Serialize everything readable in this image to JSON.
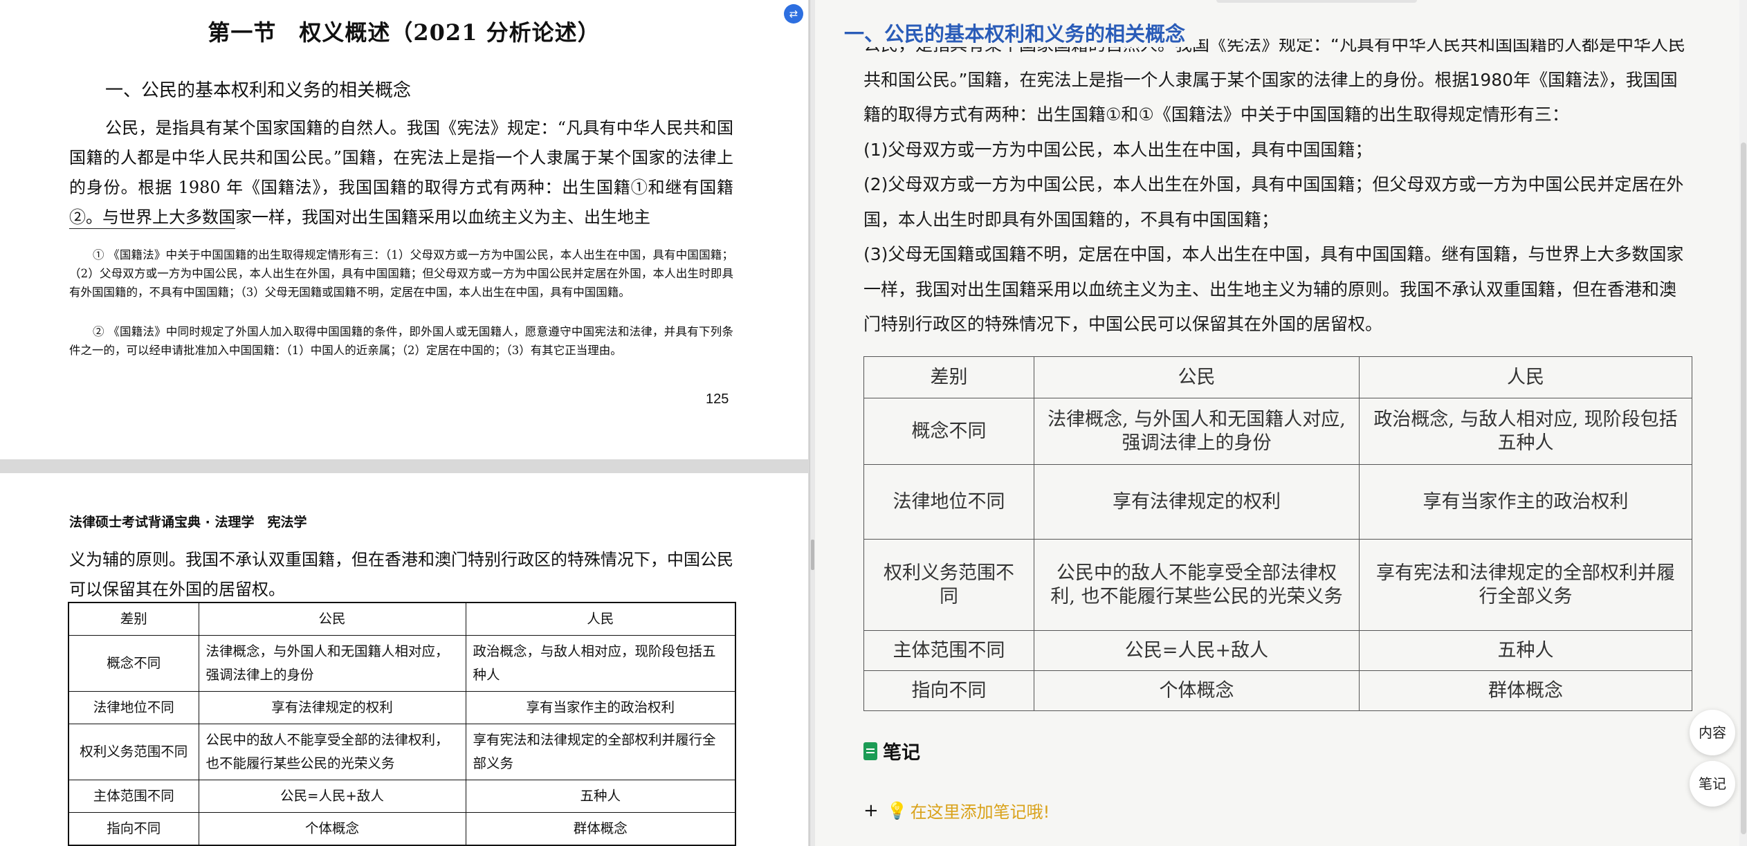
{
  "left_pdf": {
    "page1": {
      "section_title": "第一节　权义概述（2021 分析论述）",
      "subtitle": "一、公民的基本权利和义务的相关概念",
      "body": "公民，是指具有某个国家国籍的自然人。我国《宪法》规定：“凡具有中华人民共和国国籍的人都是中华人民共和国公民。”国籍，在宪法上是指一个人隶属于某个国家的法律上的身份。根据 1980 年《国籍法》，我国国籍的取得方式有两种：出生国籍①和继有国籍②。与世界上大多数国家一样，我国对出生国籍采用以血统主义为主、出生地主",
      "footnote1": "① 《国籍法》中关于中国国籍的出生取得规定情形有三：（1）父母双方或一方为中国公民，本人出生在中国，具有中国国籍；（2）父母双方或一方为中国公民，本人出生在外国，具有中国国籍；但父母双方或一方为中国公民并定居在外国，本人出生时即具有外国国籍的，不具有中国国籍；（3）父母无国籍或国籍不明，定居在中国，本人出生在中国，具有中国国籍。",
      "footnote2": "② 《国籍法》中同时规定了外国人加入取得中国国籍的条件，即外国人或无国籍人，愿意遵守中国宪法和法律，并具有下列条件之一的，可以经申请批准加入中国国籍：（1）中国人的近亲属；（2）定居在中国的；（3）有其它正当理由。",
      "page_number": "125"
    },
    "page2": {
      "header": "法律硕士考试背诵宝典 · 法理学　宪法学",
      "body": "义为辅的原则。我国不承认双重国籍，但在香港和澳门特别行政区的特殊情况下，中国公民可以保留其在外国的居留权。",
      "table": {
        "headers": [
          "差别",
          "公民",
          "人民"
        ],
        "rows": [
          [
            "概念不同",
            "法律概念，与外国人和无国籍人相对应，强调法律上的身份",
            "政治概念，与敌人相对应，现阶段包括五种人"
          ],
          [
            "法律地位不同",
            "享有法律规定的权利",
            "享有当家作主的政治权利"
          ],
          [
            "权利义务范围不同",
            "公民中的敌人不能享受全部的法律权利，也不能履行某些公民的光荣义务",
            "享有宪法和法律规定的全部权利并履行全部义务"
          ],
          [
            "主体范围不同",
            "公民=人民+敌人",
            "五种人"
          ],
          [
            "指向不同",
            "个体概念",
            "群体概念"
          ]
        ]
      }
    }
  },
  "right_panel": {
    "heading": "一、公民的基本权利和义务的相关概念",
    "paragraphs": [
      "公民，是指具有某个国家国籍的自然人。我国《宪法》规定：“凡具有中华人民共和国国籍的人都是中华人民共和国公民。”国籍，在宪法上是指一个人隶属于某个国家的法律上的身份。根据1980年《国籍法》，我国国籍的取得方式有两种：出生国籍①和①《国籍法》中关于中国国籍的出生取得规定情形有三：",
      "(1)父母双方或一方为中国公民，本人出生在中国，具有中国国籍；",
      "(2)父母双方或一方为中国公民，本人出生在外国，具有中国国籍；但父母双方或一方为中国公民并定居在外国，本人出生时即具有外国国籍的，不具有中国国籍；",
      "(3)父母无国籍或国籍不明，定居在中国，本人出生在中国，具有中国国籍。继有国籍，与世界上大多数国家一样，我国对出生国籍采用以血统主义为主、出生地主义为辅的原则。我国不承认双重国籍，但在香港和澳门特别行政区的特殊情况下，中国公民可以保留其在外国的居留权。"
    ],
    "table": {
      "headers": [
        "差别",
        "公民",
        "人民"
      ],
      "rows": [
        [
          "概念不同",
          "法律概念, 与外国人和无国籍人对应, 强调法律上的身份",
          "政治概念, 与敌人相对应, 现阶段包括五种人"
        ],
        [
          "法律地位不同",
          "享有法律规定的权利",
          "享有当家作主的政治权利"
        ],
        [
          "权利义务范围不同",
          "公民中的敌人不能享受全部法律权利, 也不能履行某些公民的光荣义务",
          "享有宪法和法律规定的全部权利并履行全部义务"
        ],
        [
          "主体范围不同",
          "公民=人民+敌人",
          "五种人"
        ],
        [
          "指向不同",
          "个体概念",
          "群体概念"
        ]
      ]
    },
    "notes_title": "笔记",
    "add_note_plus": "+",
    "add_note_text": "在这里添加笔记哦!",
    "side_buttons": {
      "content": "内容",
      "notes": "笔记"
    }
  },
  "icons": {
    "float": "translate-icon",
    "note": "clipboard-icon",
    "bulb": "lightbulb-icon"
  },
  "colors": {
    "heading_blue": "#2a5cb8",
    "note_green": "#1c9c55",
    "note_hint": "#d9a21a",
    "float_blue": "#2d6fe0"
  }
}
